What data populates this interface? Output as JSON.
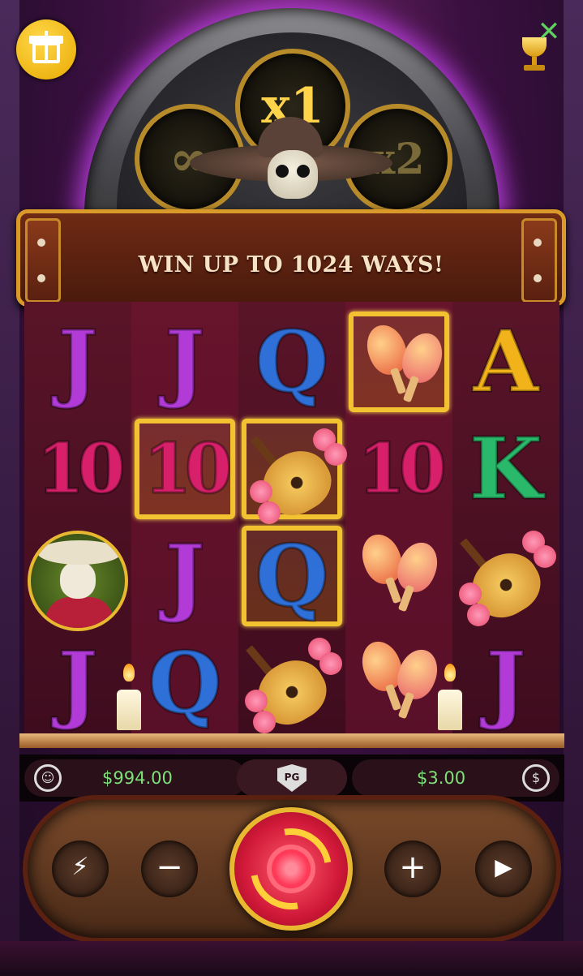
{
  "banner": {
    "text": "WIN UP TO 1024 WAYS!"
  },
  "multipliers": {
    "left": "∞",
    "center": "x1",
    "right": "x2"
  },
  "reels": {
    "columns": [
      [
        "J",
        "10",
        "wild-mariachi",
        "J"
      ],
      [
        "J",
        "10",
        "J",
        "Q"
      ],
      [
        "Q",
        "guitar",
        "Q",
        "guitar"
      ],
      [
        "maracas",
        "10",
        "maracas",
        "maracas"
      ],
      [
        "A",
        "K",
        "guitar",
        "J"
      ]
    ]
  },
  "symbols": {
    "J": {
      "text": "J",
      "color": "#b23ad6"
    },
    "Q": {
      "text": "Q",
      "color": "#2f6fd8"
    },
    "K": {
      "text": "K",
      "color": "#2ab86a"
    },
    "A": {
      "text": "A",
      "color": "#f2b21a"
    },
    "10": {
      "text": "10",
      "color": "#d8206a"
    }
  },
  "status": {
    "balance": "$994.00",
    "bet": "$3.00",
    "provider_badge": "PG"
  },
  "controls": {
    "minus": "−",
    "plus": "+"
  },
  "icons": {
    "gift": "gift-icon",
    "trophy": "trophy-icon",
    "close": "close-icon",
    "account": "account-icon",
    "coin": "coin-icon",
    "turbo": "turbo-off-icon",
    "autoplay": "autoplay-icon",
    "spin": "spin-icon"
  },
  "close_glyph": "✕"
}
